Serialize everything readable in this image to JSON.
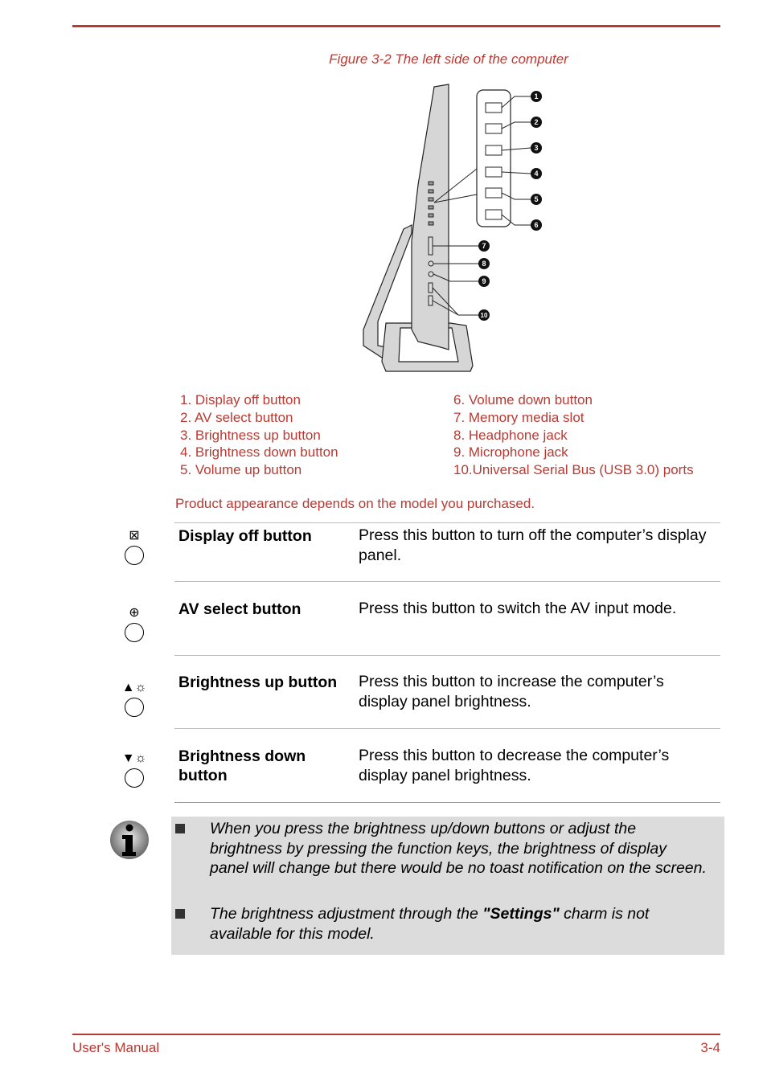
{
  "figure": {
    "caption": "Figure 3-2 The left side of the computer",
    "callouts": [
      "1",
      "2",
      "3",
      "4",
      "5",
      "6",
      "7",
      "8",
      "9",
      "10"
    ]
  },
  "legend": {
    "left": [
      "1. Display off button",
      "2. AV select button",
      "3. Brightness up button",
      "4. Brightness down button",
      "5. Volume up button"
    ],
    "right": [
      "6. Volume down button",
      "7. Memory media slot",
      "8. Headphone jack",
      "9. Microphone jack",
      "10.Universal Serial Bus (USB 3.0) ports"
    ]
  },
  "disclaimer": "Product appearance depends on the model you purchased.",
  "rows": [
    {
      "icon": "display-off-icon",
      "glyph": "⊠",
      "term": "Display off button",
      "desc": "Press this button to turn off the computer’s display panel."
    },
    {
      "icon": "av-select-icon",
      "glyph": "⊕",
      "term": "AV select button",
      "desc": "Press this button to switch the AV input mode."
    },
    {
      "icon": "brightness-up-icon",
      "glyph": "▲☼",
      "term": "Brightness up button",
      "desc": "Press this button to increase the computer’s display panel brightness."
    },
    {
      "icon": "brightness-down-icon",
      "glyph": "▼☼",
      "term": "Brightness down button",
      "desc": "Press this button to decrease the computer’s display panel brightness."
    }
  ],
  "note": {
    "item1": "When you press the brightness up/down buttons or adjust the brightness by pressing the function keys, the brightness of display panel will change but there would be no toast notification on the screen.",
    "item2_pre": "The brightness adjustment through the ",
    "item2_bold": "\"Settings\"",
    "item2_post": " charm is not available for this model."
  },
  "footer": {
    "left": "User's Manual",
    "right": "3-4"
  }
}
